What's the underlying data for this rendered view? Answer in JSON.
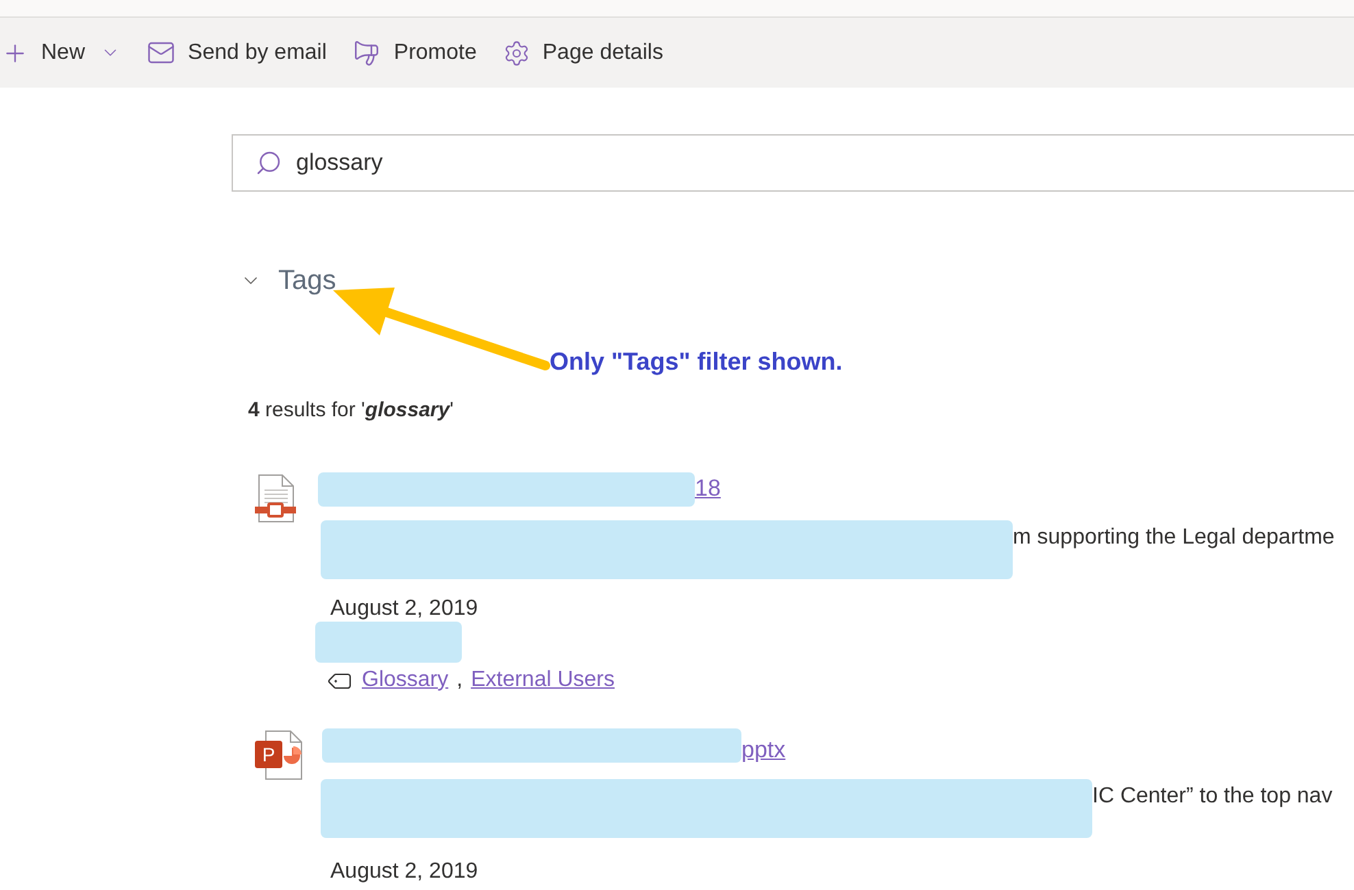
{
  "toolbar": {
    "items": [
      {
        "kind": "new",
        "label": "New"
      },
      {
        "kind": "email",
        "label": "Send by email"
      },
      {
        "kind": "promote",
        "label": "Promote"
      },
      {
        "kind": "details",
        "label": "Page details"
      }
    ]
  },
  "search": {
    "value": "glossary"
  },
  "filter": {
    "label": "Tags"
  },
  "annotation": {
    "text": "Only \"Tags\" filter shown."
  },
  "summary": "**4** results for '*glossary*'",
  "results": [
    {
      "kind": "document",
      "title_tail": "18",
      "snippet_tail": "m supporting the Legal departme",
      "date": "August 2, 2019",
      "author_redacted": true,
      "tags": {
        "items": [
          "Glossary",
          "External Users"
        ],
        "separator": ","
      }
    },
    {
      "kind": "powerpoint",
      "badge": "P",
      "title_tail": "pptx",
      "snippet_tail": "IC Center” to the top nav",
      "date": "August 2, 2019",
      "author_redacted": false
    }
  ]
}
